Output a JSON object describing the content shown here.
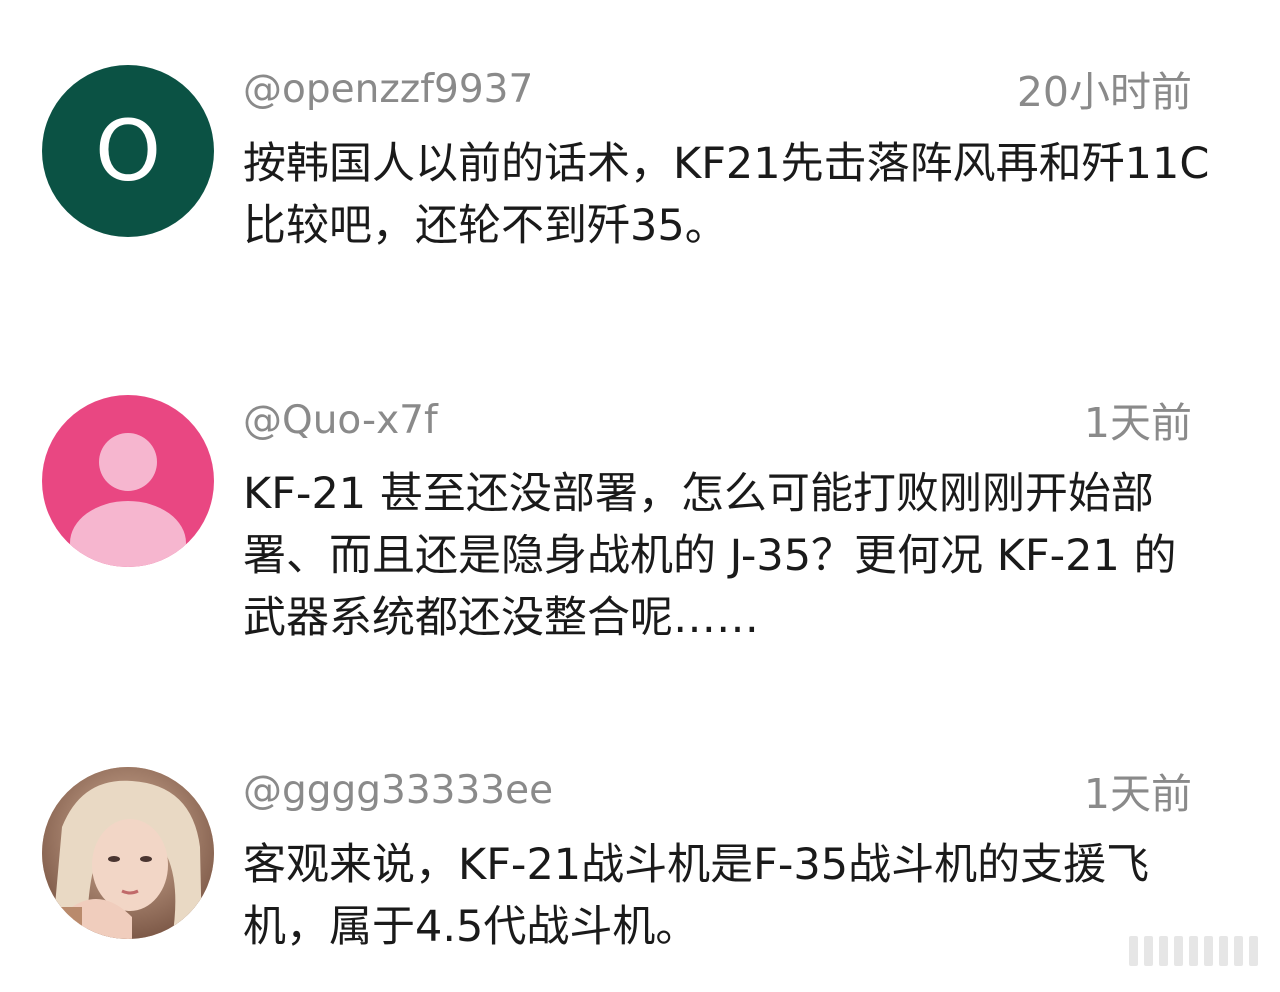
{
  "comments": [
    {
      "username": "@openzzf9937",
      "time": "20小时前",
      "text": "按韩国人以前的话术，KF21先击落阵风再和歼11C比较吧，还轮不到歼35。",
      "avatar": {
        "type": "letter",
        "letter": "O",
        "color": "#0b5244"
      }
    },
    {
      "username": "@Quo-x7f",
      "time": "1天前",
      "text": "KF-21 甚至还没部署，怎么可能打败刚刚开始部署、而且还是隐身战机的 J-35？更何况 KF-21 的武器系统都还没整合呢……",
      "avatar": {
        "type": "default-person-icon",
        "color": "#e94782",
        "icon_color": "#f6b6cf"
      }
    },
    {
      "username": "@gggg33333ee",
      "time": "1天前",
      "text": "客观来说，KF-21战斗机是F-35战斗机的支援飞机，属于4.5代战斗机。",
      "avatar": {
        "type": "photo",
        "color": "#c9a48c"
      }
    }
  ]
}
